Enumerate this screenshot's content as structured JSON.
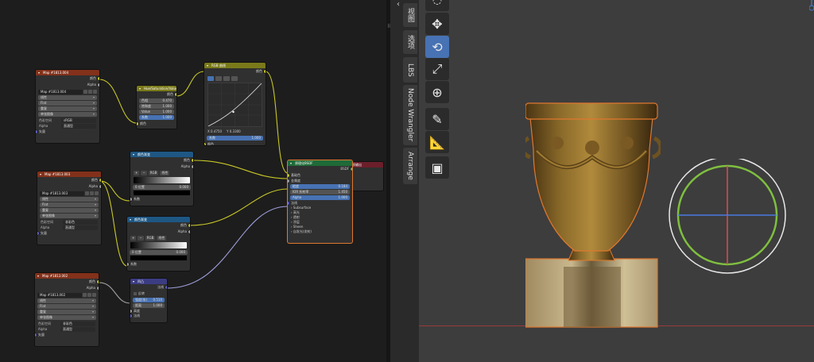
{
  "sidebar_tabs": [
    "视图",
    "选项",
    "LBS",
    "Node Wrangler",
    "Arrange"
  ],
  "tools": [
    {
      "name": "move-tool",
      "glyph": "✥",
      "active": false
    },
    {
      "name": "rotate-tool",
      "glyph": "⟲",
      "active": true
    },
    {
      "name": "scale-tool",
      "glyph": "⤢",
      "active": false
    },
    {
      "name": "transform-tool",
      "glyph": "⊕",
      "active": false
    },
    {
      "name": "annotate-tool",
      "glyph": "✎",
      "active": false
    },
    {
      "name": "measure-tool",
      "glyph": "📐",
      "active": false
    },
    {
      "name": "add-cube-tool",
      "glyph": "▣",
      "active": false
    }
  ],
  "image_nodes": [
    {
      "title": "Map #1813.004",
      "image_name": "Map #1813.004",
      "outputs": [
        "颜色",
        "Alpha"
      ],
      "dropdowns": [
        "线性",
        "Flat",
        "重复"
      ],
      "single_source": "单张图像",
      "color_space_label": "色彩空间",
      "color_space_value": "sRGB",
      "alpha_label": "Alpha",
      "alpha_value": "直通型",
      "vector_input": "矢量"
    },
    {
      "title": "Map #1813.003",
      "image_name": "Map #1813.003",
      "outputs": [
        "颜色",
        "Alpha"
      ],
      "dropdowns": [
        "线性",
        "Flat",
        "重复"
      ],
      "single_source": "单张图像",
      "color_space_label": "色彩空间",
      "color_space_value": "非彩色",
      "alpha_label": "Alpha",
      "alpha_value": "直通型",
      "vector_input": "矢量"
    },
    {
      "title": "Map #1813.002",
      "image_name": "Map #1813.002",
      "outputs": [
        "颜色",
        "Alpha"
      ],
      "dropdowns": [
        "线性",
        "Flat",
        "重复"
      ],
      "single_source": "单张图像",
      "color_space_label": "色彩空间",
      "color_space_value": "非彩色",
      "alpha_label": "Alpha",
      "alpha_value": "直通型",
      "vector_input": "矢量"
    }
  ],
  "hsv_node": {
    "title": "Hue/Saturation/Value",
    "output": "颜色",
    "fields": [
      {
        "label": "色相",
        "value": "0.470"
      },
      {
        "label": "饱和度",
        "value": "1.000"
      },
      {
        "label": "Value",
        "value": "1.000"
      },
      {
        "label": "系数",
        "value": "1.000"
      }
    ],
    "input": "颜色"
  },
  "rgb_curves": {
    "title": "RGB 曲线",
    "output": "颜色",
    "coord_x": "X 0.4750",
    "coord_y": "Y 0.3300",
    "factor_label": "系数",
    "factor_value": "1.000",
    "input": "颜色"
  },
  "color_ramp_1": {
    "title": "颜色渐变",
    "outputs": [
      "颜色",
      "Alpha"
    ],
    "mode": "RGB",
    "interp": "线性",
    "stop_index": "0",
    "stop_pos_label": "位置",
    "stop_pos_value": "0.000",
    "input": "系数"
  },
  "color_ramp_2": {
    "title": "颜色渐变",
    "outputs": [
      "颜色",
      "Alpha"
    ],
    "mode": "RGB",
    "interp": "线性",
    "stop_index": "0",
    "stop_pos_label": "位置",
    "stop_pos_value": "0.000",
    "input": "系数"
  },
  "bump_node": {
    "title": "凹凸",
    "output": "法线",
    "invert_label": "反转",
    "fields": [
      {
        "label": "强度(系)",
        "value": "0.510"
      },
      {
        "label": "距离",
        "value": "1.000"
      }
    ],
    "inputs": [
      "高度",
      "法线"
    ]
  },
  "principled": {
    "title": "原理化BSDF",
    "output": "BSDF",
    "rows_top": [
      "基础色",
      "金属度"
    ],
    "fields": [
      {
        "label": "糙度",
        "value": "0.184"
      },
      {
        "label": "IOR 折射率",
        "value": "1.450"
      },
      {
        "label": "Alpha",
        "value": "1.000"
      }
    ],
    "rows_bottom": [
      "法线",
      "Subsurface",
      "高光",
      "透射",
      "涂层",
      "Sheen",
      "自发光(发射)"
    ]
  },
  "material_output": {
    "title": "材质输出"
  },
  "colors": {
    "accent_blue": "#4772b3",
    "selection_orange": "#e0782f",
    "image_header": "#83311a",
    "converter_header": "#7a7a1a",
    "input_header": "#1e5784",
    "vector_header": "#3c3c83",
    "shader_header": "#1f6b38",
    "output_header": "#6b1f2b"
  }
}
